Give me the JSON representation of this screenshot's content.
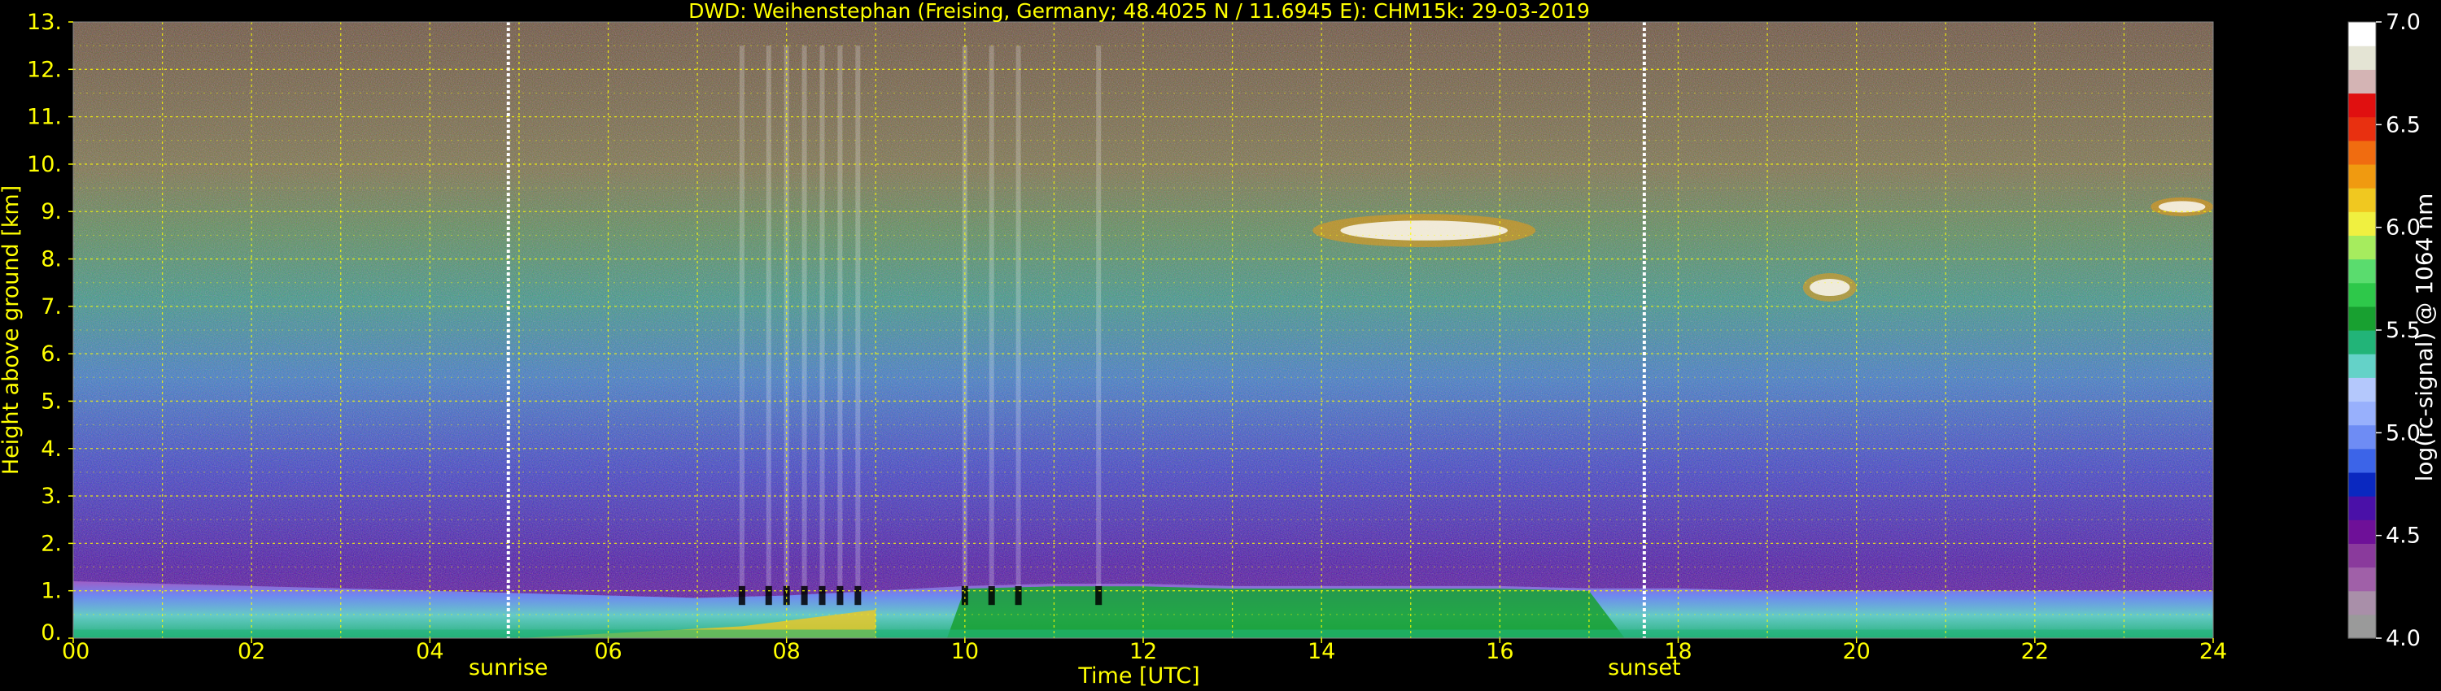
{
  "chart_data": {
    "type": "heatmap",
    "title": "DWD: Weihenstephan (Freising, Germany; 48.4025 N / 11.6945 E):    CHM15k: 29-03-2019",
    "xlabel": "Time [UTC]",
    "ylabel": "Height above ground [km]",
    "colorbar_label": "log(rc-signal) @ 1064 nm",
    "xlim": [
      0,
      24
    ],
    "ylim": [
      0,
      13
    ],
    "x_ticks": [
      "00",
      "02",
      "04",
      "06",
      "08",
      "10",
      "12",
      "14",
      "16",
      "18",
      "20",
      "22",
      "24"
    ],
    "y_ticks": [
      "0.",
      "1.",
      "2.",
      "3.",
      "4.",
      "5.",
      "6.",
      "7.",
      "8.",
      "9.",
      "10.",
      "11.",
      "12.",
      "13."
    ],
    "colorbar_range": [
      4.0,
      7.0
    ],
    "colorbar_ticks": [
      "4.0",
      "4.5",
      "5.0",
      "5.5",
      "6.0",
      "6.5",
      "7.0"
    ],
    "grid": true,
    "markers": [
      {
        "label": "sunrise",
        "time": 4.88
      },
      {
        "label": "sunset",
        "time": 17.62
      }
    ],
    "boundary_layer_top_km": [
      [
        0,
        1.2
      ],
      [
        1,
        1.15
      ],
      [
        2,
        1.1
      ],
      [
        3,
        1.05
      ],
      [
        4,
        1.0
      ],
      [
        5,
        0.95
      ],
      [
        6,
        0.9
      ],
      [
        7,
        0.85
      ],
      [
        8,
        0.9
      ],
      [
        9,
        1.0
      ],
      [
        10,
        1.1
      ],
      [
        11,
        1.15
      ],
      [
        12,
        1.15
      ],
      [
        13,
        1.1
      ],
      [
        14,
        1.1
      ],
      [
        15,
        1.1
      ],
      [
        16,
        1.1
      ],
      [
        17,
        1.05
      ],
      [
        18,
        1.05
      ],
      [
        19,
        1.0
      ],
      [
        20,
        1.0
      ],
      [
        21,
        1.0
      ],
      [
        22,
        1.0
      ],
      [
        23,
        1.0
      ],
      [
        24,
        1.0
      ]
    ],
    "cloud_layers": [
      {
        "t_start": 13.9,
        "t_end": 16.4,
        "h_center": 8.6,
        "h_thick": 0.7
      },
      {
        "t_start": 19.4,
        "t_end": 20.0,
        "h_center": 7.4,
        "h_thick": 0.6
      },
      {
        "t_start": 23.3,
        "t_end": 24.0,
        "h_center": 9.1,
        "h_thick": 0.4
      }
    ],
    "precip_streaks_time": [
      7.5,
      7.8,
      8.0,
      8.2,
      8.4,
      8.6,
      8.8,
      10.0,
      10.3,
      10.6,
      11.5
    ],
    "colors": {
      "title": "#ffff00",
      "axes_text": "#ffff00",
      "grid": "#ffff00",
      "colorbar_text": "#ffffff",
      "marker_line": "#ffffff",
      "colormap": [
        "#9a9a9a",
        "#a98fa9",
        "#a060a8",
        "#8a3a9c",
        "#6e1098",
        "#4a10a8",
        "#0a28c0",
        "#3c64e8",
        "#6e8cf4",
        "#98b0fc",
        "#b4c8fc",
        "#64d2c8",
        "#22b478",
        "#18a030",
        "#2ec84a",
        "#5adc6e",
        "#a6ec5e",
        "#f0f040",
        "#f0c820",
        "#f09a10",
        "#f06c10",
        "#e83010",
        "#e01010",
        "#d4b4b4",
        "#e4e4d4",
        "#ffffff"
      ]
    }
  }
}
